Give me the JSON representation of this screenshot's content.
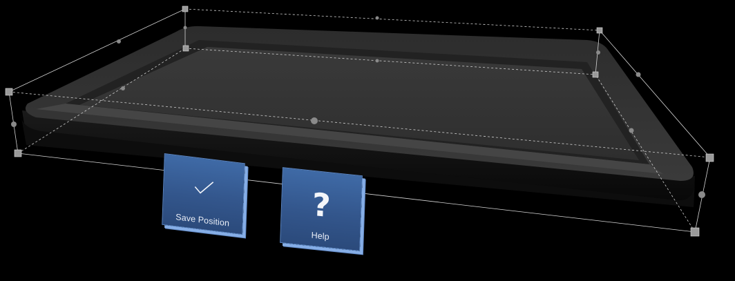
{
  "scene": {
    "description_icon": "hologram-bounding-box",
    "accent_color": "#3b5f99",
    "highlight_color": "#86aee6"
  },
  "buttons": {
    "save": {
      "label": "Save Position",
      "icon": "checkmark-icon"
    },
    "help": {
      "label": "Help",
      "icon": "question-mark-icon",
      "glyph": "?"
    }
  }
}
